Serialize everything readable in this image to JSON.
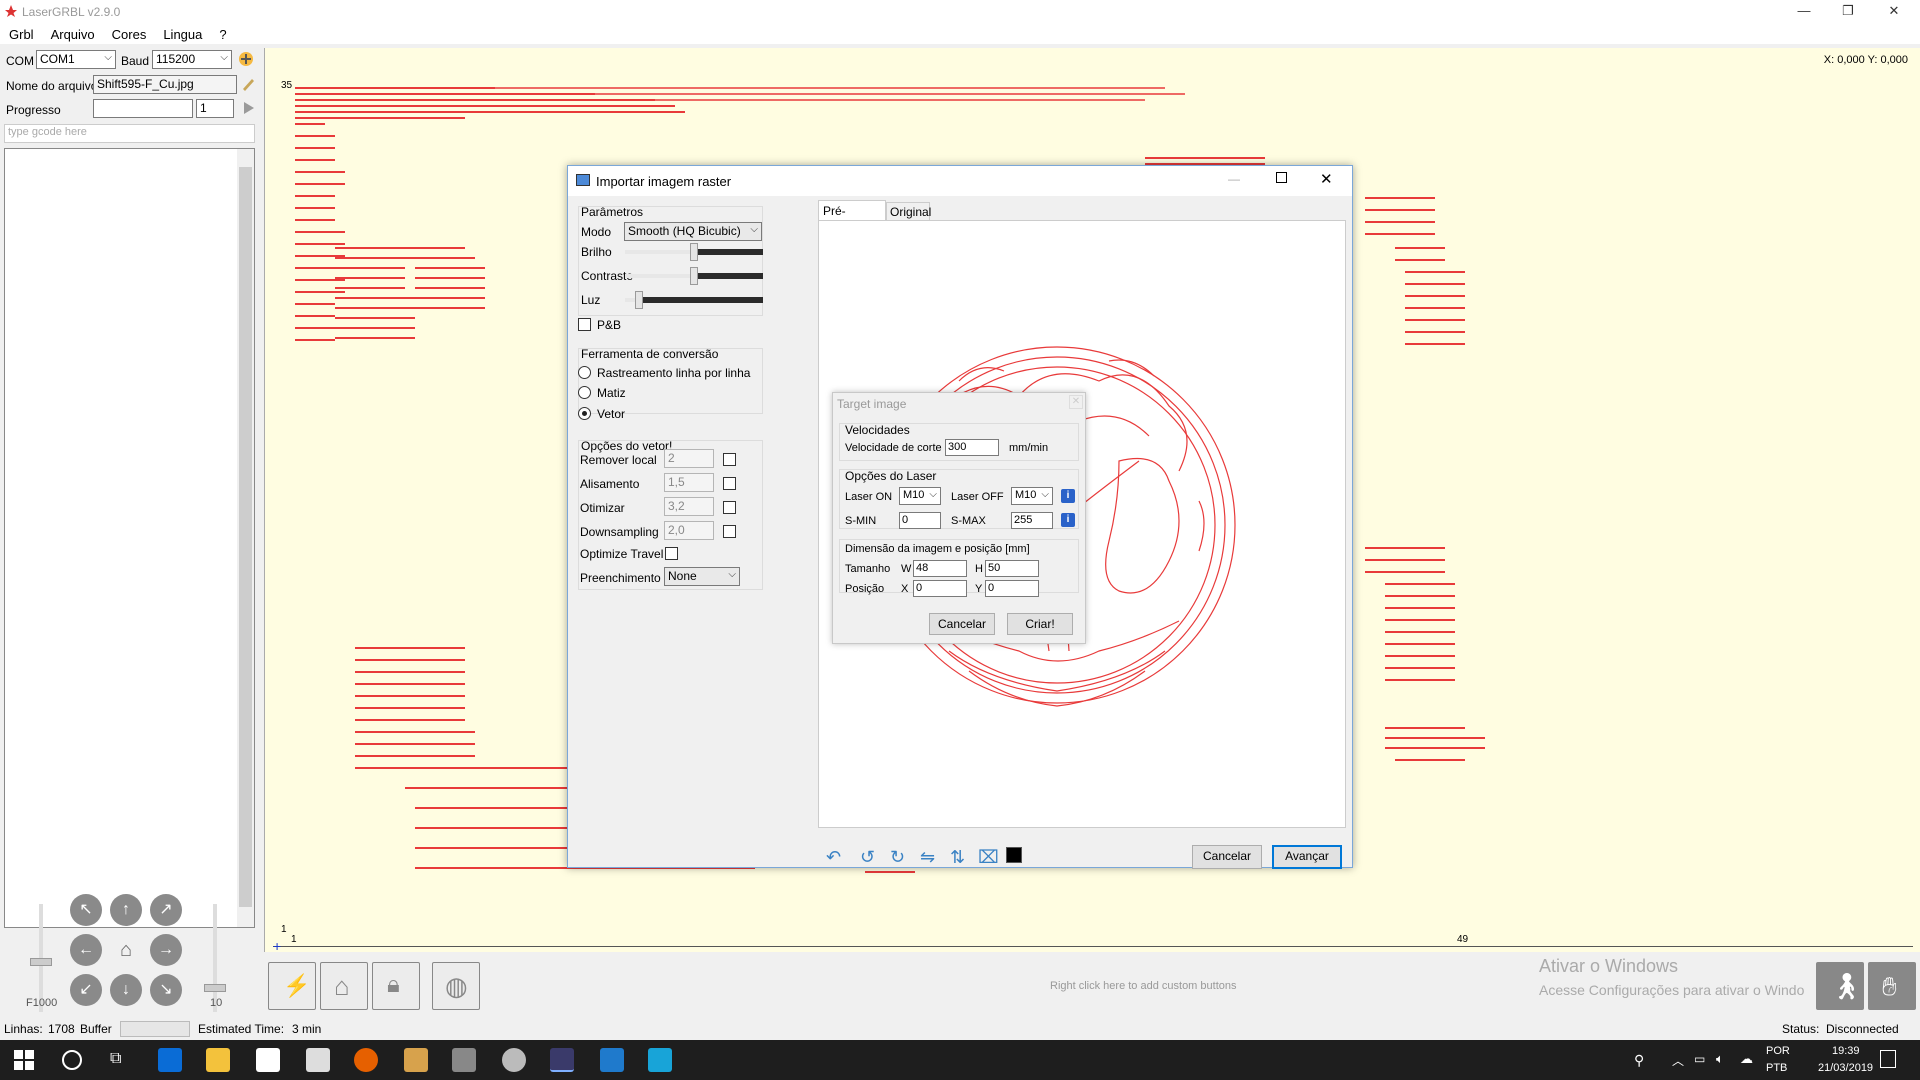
{
  "app": {
    "title": "LaserGRBL v2.9.0"
  },
  "menu": [
    "Grbl",
    "Arquivo",
    "Cores",
    "Lingua",
    "?"
  ],
  "conn": {
    "com_label": "COM",
    "com_value": "COM1",
    "baud_label": "Baud",
    "baud_value": "115200"
  },
  "file": {
    "label": "Nome do arquivo",
    "value": "Shift595-F_Cu.jpg"
  },
  "progress": {
    "label": "Progresso",
    "count": "1"
  },
  "gcode": {
    "placeholder": "type gcode here"
  },
  "jog": {
    "speed": "F1000",
    "step": "10"
  },
  "canvas": {
    "coords": "X: 0,000 Y: 0,000",
    "y_top": "35",
    "y_bottom": "1",
    "x_left": "1",
    "x_right": "49",
    "custom_hint": "Right click here to add custom buttons"
  },
  "activation": {
    "title": "Ativar o Windows",
    "subtitle": "Acesse Configurações para ativar o Windo"
  },
  "statusbar": {
    "lines_label": "Linhas:",
    "lines_value": "1708",
    "buffer_label": "Buffer",
    "time_label": "Estimated Time:",
    "time_value": "3 min",
    "status_label": "Status:",
    "status_value": "Disconnected"
  },
  "taskbar": {
    "lang1": "POR",
    "lang2": "PTB",
    "time": "19:39",
    "date": "21/03/2019"
  },
  "import_dialog": {
    "title": "Importar imagem raster",
    "params": {
      "title": "Parâmetros",
      "mode_label": "Modo",
      "mode_value": "Smooth (HQ Bicubic)",
      "brightness_label": "Brilho",
      "contrast_label": "Contraste",
      "light_label": "Luz",
      "bw_label": "P&B",
      "brightness": 0.5,
      "contrast": 0.5,
      "light": 0.1
    },
    "conversion": {
      "title": "Ferramenta de conversão",
      "options": [
        "Rastreamento linha por linha",
        "Matiz",
        "Vetor"
      ],
      "selected": "Vetor"
    },
    "vector": {
      "title": "Opções do vetor!",
      "remove_label": "Remover local",
      "remove_value": "2",
      "smooth_label": "Alisamento",
      "smooth_value": "1,5",
      "optimize_label": "Otimizar",
      "optimize_value": "3,2",
      "downsampling_label": "Downsampling",
      "downsampling_value": "2,0",
      "travel_label": "Optimize Travel",
      "fill_label": "Preenchimento",
      "fill_value": "None"
    },
    "tabs": [
      "Pré-Visualizar",
      "Original"
    ],
    "cancel": "Cancelar",
    "next": "Avançar"
  },
  "target_dialog": {
    "title": "Target image",
    "speeds_title": "Velocidades",
    "cut_label": "Velocidade de corte",
    "cut_value": "300",
    "cut_unit": "mm/min",
    "laser_title": "Opções do Laser",
    "on_label": "Laser ON",
    "on_value": "M10",
    "off_label": "Laser OFF",
    "off_value": "M10",
    "smin_label": "S-MIN",
    "smin_value": "0",
    "smax_label": "S-MAX",
    "smax_value": "255",
    "dim_title": "Dimensão da imagem e posição [mm]",
    "size_label": "Tamanho",
    "w_label": "W",
    "w_value": "48",
    "h_label": "H",
    "h_value": "50",
    "pos_label": "Posição",
    "x_label": "X",
    "x_value": "0",
    "y_label": "Y",
    "y_value": "0",
    "cancel": "Cancelar",
    "create": "Criar!"
  },
  "colors": {
    "accent": "#0078d7",
    "path": "#e83a3a",
    "canvas": "#fffde1"
  }
}
